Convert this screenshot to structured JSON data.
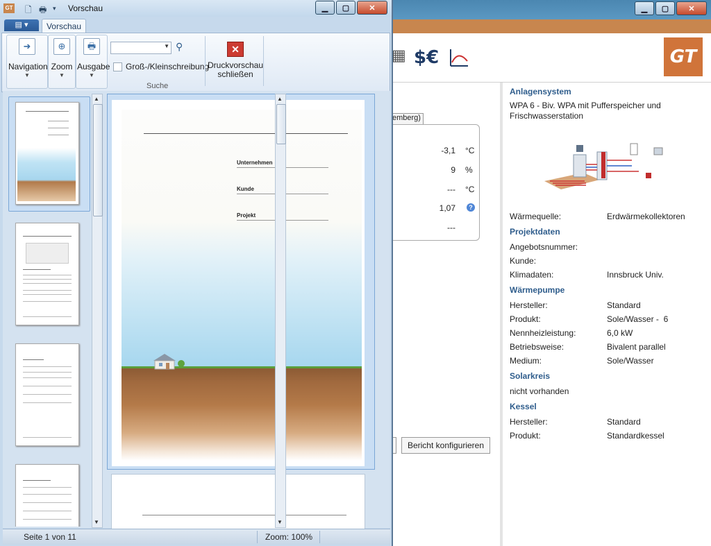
{
  "preview_window": {
    "title": "Vorschau",
    "app_icon": "GT",
    "file_menu_label": "▤ ▾",
    "tab_label": "Vorschau",
    "ribbon": {
      "navigation_label": "Navigation",
      "zoom_label": "Zoom",
      "ausgabe_label": "Ausgabe",
      "search_value": "",
      "case_label": "Groß-/Kleinschreibung",
      "case_checked": false,
      "search_group_label": "Suche",
      "close_preview_label": "Druckvorschau schließen"
    },
    "page": {
      "fields": [
        "Unternehmen",
        "Kunde",
        "Projekt"
      ]
    },
    "status": {
      "page_info": "Seite 1 von 11",
      "zoom_info": "Zoom: 100%"
    }
  },
  "background_app": {
    "toolbar_icons": [
      "calculator-icon",
      "dollar-euro-icon",
      "graph-icon"
    ],
    "currency_label": "$€",
    "logo": "GT",
    "tab_partial_label": "emberg)",
    "data_rows": [
      {
        "value": "-3,1",
        "unit": "°C"
      },
      {
        "value": "9",
        "unit": "%"
      },
      {
        "value": "---",
        "unit": "°C"
      },
      {
        "value": "1,07",
        "unit": ""
      },
      {
        "value": "---",
        "unit": ""
      }
    ],
    "report_button": "Bericht konfigurieren",
    "right_panel": {
      "anlagensystem_title": "Anlagensystem",
      "anlagensystem_desc": "WPA 6 - Biv. WPA mit Pufferspeicher und Frischwasserstation",
      "waermequelle_label": "Wärmequelle:",
      "waermequelle_value": "Erdwärmekollektoren",
      "projektdaten_title": "Projektdaten",
      "angebotsnummer_label": "Angebotsnummer:",
      "kunde_label": "Kunde:",
      "klimadaten_label": "Klimadaten:",
      "klimadaten_value": "Innsbruck Univ.",
      "waermepumpe_title": "Wärmepumpe",
      "wp_hersteller_label": "Hersteller:",
      "wp_hersteller_value": "Standard",
      "produkt_label": "Produkt:",
      "produkt_value": "Sole/Wasser -  6",
      "nennheiz_label": "Nennheizleistung:",
      "nennheiz_value": "6,0 kW",
      "betriebsweise_label": "Betriebsweise:",
      "betriebsweise_value": "Bivalent parallel",
      "medium_label": "Medium:",
      "medium_value": "Sole/Wasser",
      "solarkreis_title": "Solarkreis",
      "solarkreis_value": "nicht vorhanden",
      "kessel_title": "Kessel",
      "kessel_hersteller_label": "Hersteller:",
      "kessel_hersteller_value": "Standard",
      "kessel_produkt_label": "Produkt:",
      "kessel_produkt_value": "Standardkessel"
    }
  }
}
